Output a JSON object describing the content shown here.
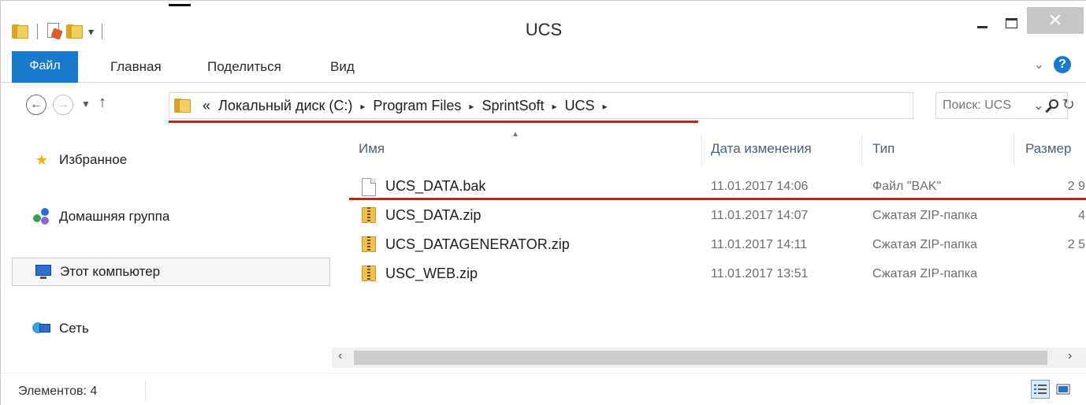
{
  "window": {
    "title": "UCS"
  },
  "ribbon": {
    "tabs": [
      "Файл",
      "Главная",
      "Поделиться",
      "Вид"
    ]
  },
  "address": {
    "prefix": "«",
    "crumbs": [
      "Локальный диск (C:)",
      "Program Files",
      "SprintSoft",
      "UCS"
    ],
    "separator": "▸"
  },
  "search": {
    "placeholder": "Поиск: UCS"
  },
  "nav": {
    "items": [
      {
        "label": "Избранное",
        "icon": "star-icon"
      },
      {
        "label": "Домашняя группа",
        "icon": "homegroup-icon"
      },
      {
        "label": "Этот компьютер",
        "icon": "computer-icon",
        "selected": true
      },
      {
        "label": "Сеть",
        "icon": "network-icon"
      }
    ]
  },
  "columns": {
    "name": "Имя",
    "date": "Дата изменения",
    "type": "Тип",
    "size": "Размер"
  },
  "files": [
    {
      "name": "UCS_DATA.bak",
      "date": "11.01.2017 14:06",
      "type": "Файл \"BAK\"",
      "size": "2 9",
      "icon": "file-icon"
    },
    {
      "name": "UCS_DATA.zip",
      "date": "11.01.2017 14:07",
      "type": "Сжатая ZIP-папка",
      "size": "4",
      "icon": "zip-folder-icon"
    },
    {
      "name": "UCS_DATAGENERATOR.zip",
      "date": "11.01.2017 14:11",
      "type": "Сжатая ZIP-папка",
      "size": "2 5",
      "icon": "zip-folder-icon"
    },
    {
      "name": "USC_WEB.zip",
      "date": "11.01.2017 13:51",
      "type": "Сжатая ZIP-папка",
      "size": "",
      "icon": "zip-folder-icon"
    }
  ],
  "status": {
    "text": "Элементов: 4"
  },
  "colors": {
    "accent": "#1979ca",
    "annotation": "#d41a1a"
  }
}
